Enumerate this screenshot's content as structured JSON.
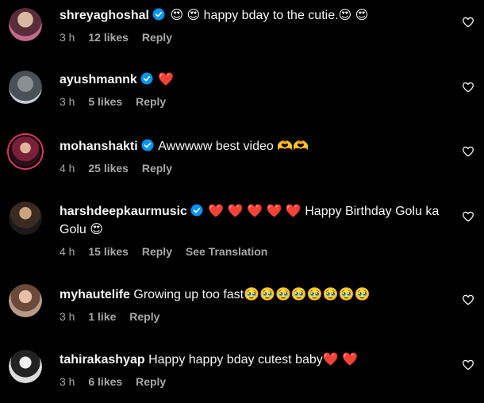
{
  "comments": [
    {
      "username": "shreyaghoshal",
      "text": "😍 😍  happy bday to the cutie.😍 😍",
      "time": "3 h",
      "likes": "12 likes",
      "reply": "Reply"
    },
    {
      "username": "ayushmannk",
      "text": "❤️",
      "time": "3 h",
      "likes": "5 likes",
      "reply": "Reply"
    },
    {
      "username": "mohanshakti",
      "text": "Awwwww best video 🫶🫶",
      "time": "4 h",
      "likes": "25 likes",
      "reply": "Reply"
    },
    {
      "username": "harshdeepkaurmusic",
      "text": "❤️ ❤️ ❤️ ❤️ ❤️  Happy Birthday Golu ka Golu 😍",
      "time": "4 h",
      "likes": "15 likes",
      "reply": "Reply",
      "translate": "See Translation"
    },
    {
      "username": "myhautelife",
      "text": "Growing up too fast🥹🥹🥹🥹🥹🥹🥹🥹",
      "time": "3 h",
      "likes": "1 like",
      "reply": "Reply"
    },
    {
      "username": "tahirakashyap",
      "text": "Happy happy bday cutest baby❤️ ❤️",
      "time": "3 h",
      "likes": "6 likes",
      "reply": "Reply"
    }
  ],
  "colors": {
    "background": "#000000",
    "primary_text": "#f5f5f5",
    "secondary_text": "#a8a8a8",
    "verified_badge": "#0095f6",
    "story_ring": "#e1306c"
  },
  "icons": {
    "verified": "verified-badge-icon",
    "like": "heart-outline-icon"
  }
}
